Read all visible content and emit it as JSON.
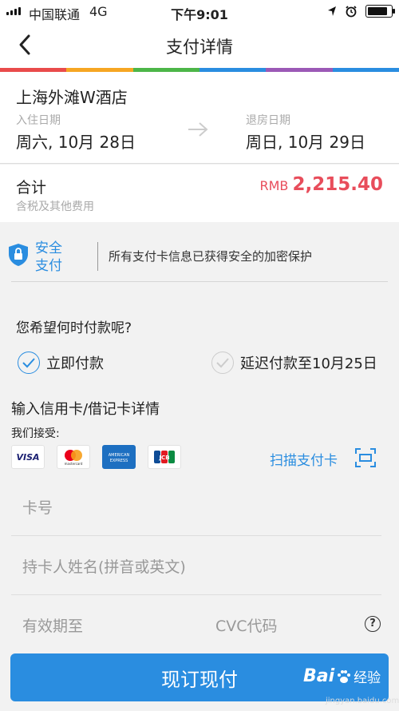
{
  "status_bar": {
    "carrier": "中国联通",
    "network": "4G",
    "time": "下午9:01",
    "battery_level": 0.9
  },
  "nav": {
    "back_icon": "chevron-left-icon",
    "title": "支付详情"
  },
  "colors": {
    "accent": "#2a8de0",
    "price": "#e84d5b",
    "rainbow": [
      "#e94b4b",
      "#f6a623",
      "#4cb648",
      "#2a8de0",
      "#9b59b6",
      "#2a8de0"
    ]
  },
  "hotel": {
    "name": "上海外滩W酒店",
    "checkin_label": "入住日期",
    "checkin_date": "周六, 10月 28日",
    "checkout_label": "退房日期",
    "checkout_date": "周日, 10月 29日"
  },
  "total": {
    "label": "合计",
    "sublabel": "含税及其他费用",
    "currency": "RMB",
    "amount": "2,215.40"
  },
  "security": {
    "badge": "安全支付",
    "message": "所有支付卡信息已获得安全的加密保护"
  },
  "payment_timing": {
    "question": "您希望何时付款呢?",
    "options": [
      {
        "label": "立即付款",
        "selected": true
      },
      {
        "label": "延迟付款至10月25日",
        "selected": false
      }
    ]
  },
  "card": {
    "header": "输入信用卡/借记卡详情",
    "accepted_label": "我们接受:",
    "brands": [
      "VISA",
      "mastercard",
      "AMERICAN EXPRESS",
      "JCB"
    ],
    "scan_label": "扫描支付卡",
    "number_placeholder": "卡号",
    "name_placeholder": "持卡人姓名(拼音或英文)",
    "expiry_placeholder": "有效期至",
    "cvc_placeholder": "CVC代码",
    "help_symbol": "?"
  },
  "submit_label": "现订现付",
  "watermark": {
    "brand_a": "Bai",
    "brand_b": "经验",
    "url": "jingyan.baidu.com"
  }
}
